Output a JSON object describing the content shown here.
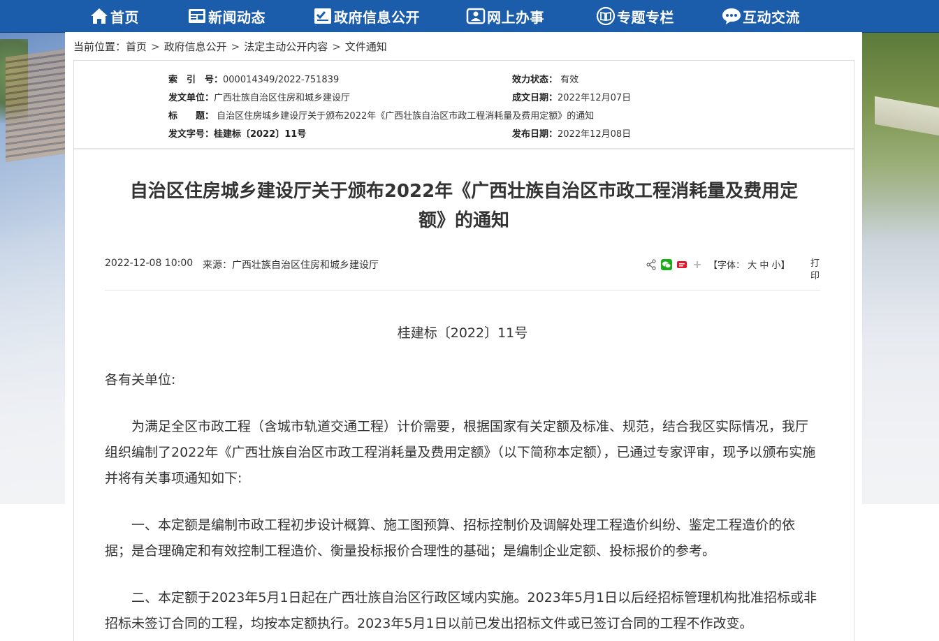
{
  "nav": {
    "items": [
      {
        "label": "首页",
        "icon": "home-icon"
      },
      {
        "label": "新闻动态",
        "icon": "news-icon"
      },
      {
        "label": "政府信息公开",
        "icon": "document-check-icon"
      },
      {
        "label": "网上办事",
        "icon": "id-card-icon"
      },
      {
        "label": "专题专栏",
        "icon": "book-icon"
      },
      {
        "label": "互动交流",
        "icon": "chat-bubble-icon"
      }
    ]
  },
  "breadcrumb": {
    "prefix": "当前位置：",
    "items": [
      "首页",
      "政府信息公开",
      "法定主动公开内容",
      "文件通知"
    ],
    "separator": ">"
  },
  "meta": {
    "index_label": "索　引　号：",
    "index_value": "000014349/2022-751839",
    "status_label": "效力状态：",
    "status_value": "有效",
    "issuer_label": "发文单位：",
    "issuer_value": "广西壮族自治区住房和城乡建设厅",
    "created_label": "成文日期：",
    "created_value": "2022年12月07日",
    "title_label": "标　　题：",
    "title_value": "自治区住房城乡建设厅关于颁布2022年《广西壮族自治区市政工程消耗量及费用定额》的通知",
    "docno_label": "发文字号：",
    "docno_value": "桂建标〔2022〕11号",
    "published_label": "发布日期：",
    "published_value": "2022年12月08日"
  },
  "article": {
    "title_line1": "自治区住房城乡建设厅关于颁布2022年《广西壮族自治区市政工程消耗量及费用定",
    "title_line2": "额》的通知",
    "date": "2022-12-08 10:00",
    "source": "来源：广西壮族自治区住房和城乡建设厅",
    "font_label": "【字体：",
    "font_large": "大",
    "font_medium": "中",
    "font_small": "小",
    "font_close": "】",
    "print_label": "打印",
    "doc_number": "桂建标〔2022〕11号",
    "salutation": "各有关单位:",
    "paragraphs": [
      "为满足全区市政工程（含城市轨道交通工程）计价需要，根据国家有关定额及标准、规范，结合我区实际情况，我厅组织编制了2022年《广西壮族自治区市政工程消耗量及费用定额》（以下简称本定额），已通过专家评审，现予以颁布实施并将有关事项通知如下:",
      "一、本定额是编制市政工程初步设计概算、施工图预算、招标控制价及调解处理工程造价纠纷、鉴定工程造价的依据；是合理确定和有效控制工程造价、衡量投标报价合理性的基础；是编制企业定额、投标报价的参考。",
      "二、本定额于2023年5月1日起在广西壮族自治区行政区域内实施。2023年5月1日以后经招标管理机构批准招标或非招标未签订合同的工程，均按本定额执行。2023年5月1日以前已发出招标文件或已签订合同的工程不作改变。"
    ]
  },
  "colors": {
    "nav_bg": "#1b5cab",
    "text": "#333333",
    "wechat_green": "#1aad19",
    "weibo_red": "#e6162d"
  }
}
